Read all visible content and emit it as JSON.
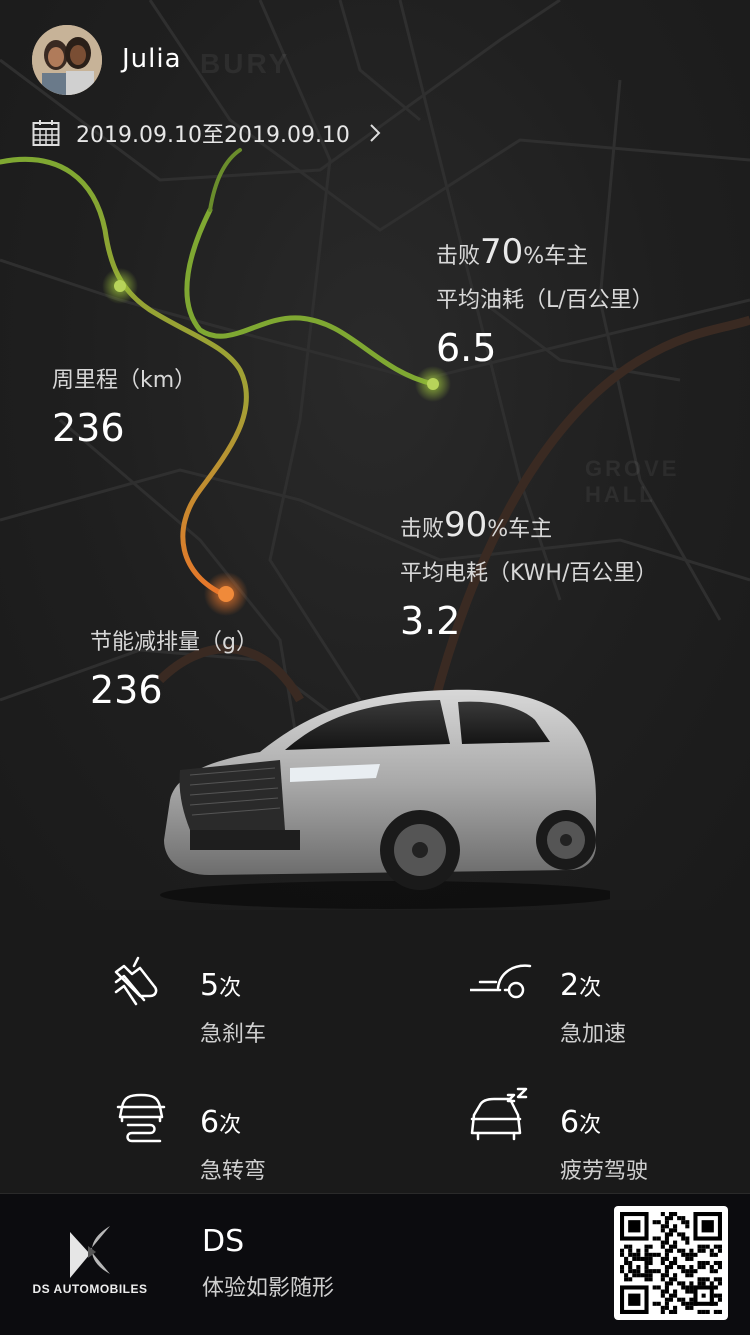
{
  "user": {
    "name": "Julia"
  },
  "date_range": {
    "text": "2019.09.10至2019.09.10"
  },
  "stats": {
    "fuel": {
      "beat_prefix": "击败",
      "beat_pct": "70",
      "beat_suffix": "%车主",
      "label": "平均油耗（L/百公里）",
      "value": "6.5"
    },
    "mileage": {
      "label": "周里程（km）",
      "value": "236"
    },
    "electric": {
      "beat_prefix": "击败",
      "beat_pct": "90",
      "beat_suffix": "%车主",
      "label": "平均电耗（KWH/百公里）",
      "value": "3.2"
    },
    "emission": {
      "label": "节能减排量（g）",
      "value": "236"
    }
  },
  "map": {
    "street_labels": [
      "BURY",
      "GROVE HALL"
    ]
  },
  "events": [
    {
      "count": "5",
      "unit": "次",
      "name": "急刹车",
      "icon": "hard-brake-icon"
    },
    {
      "count": "2",
      "unit": "次",
      "name": "急加速",
      "icon": "rapid-acceleration-icon"
    },
    {
      "count": "6",
      "unit": "次",
      "name": "急转弯",
      "icon": "sharp-turn-icon"
    },
    {
      "count": "6",
      "unit": "次",
      "name": "疲劳驾驶",
      "icon": "fatigue-driving-icon"
    }
  ],
  "footer": {
    "brand": "DS AUTOMOBILES",
    "title": "DS",
    "subtitle": "体验如影随形"
  },
  "colors": {
    "route_start": "#8fb63a",
    "route_end": "#e8762a",
    "background": "#1a1a1a"
  }
}
